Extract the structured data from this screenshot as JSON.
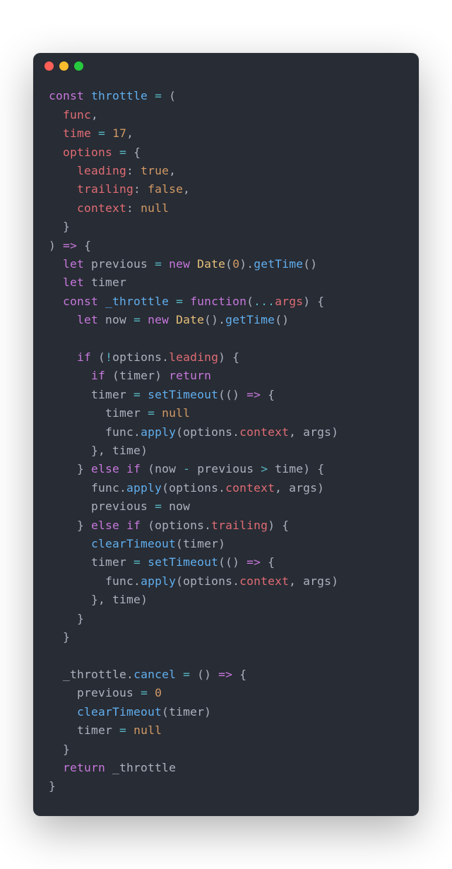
{
  "window": {
    "buttons": [
      "close",
      "minimize",
      "maximize"
    ]
  },
  "code": {
    "language": "javascript",
    "tokens": [
      {
        "t": "kw",
        "v": "const"
      },
      {
        "t": "sp",
        "v": " "
      },
      {
        "t": "fn",
        "v": "throttle"
      },
      {
        "t": "sp",
        "v": " "
      },
      {
        "t": "op",
        "v": "="
      },
      {
        "t": "sp",
        "v": " "
      },
      {
        "t": "punct",
        "v": "("
      },
      {
        "t": "nl"
      },
      {
        "t": "sp",
        "v": "  "
      },
      {
        "t": "str-param",
        "v": "func"
      },
      {
        "t": "punct",
        "v": ","
      },
      {
        "t": "nl"
      },
      {
        "t": "sp",
        "v": "  "
      },
      {
        "t": "str-param",
        "v": "time"
      },
      {
        "t": "sp",
        "v": " "
      },
      {
        "t": "op",
        "v": "="
      },
      {
        "t": "sp",
        "v": " "
      },
      {
        "t": "num",
        "v": "17"
      },
      {
        "t": "punct",
        "v": ","
      },
      {
        "t": "nl"
      },
      {
        "t": "sp",
        "v": "  "
      },
      {
        "t": "str-param",
        "v": "options"
      },
      {
        "t": "sp",
        "v": " "
      },
      {
        "t": "op",
        "v": "="
      },
      {
        "t": "sp",
        "v": " "
      },
      {
        "t": "punct",
        "v": "{"
      },
      {
        "t": "nl"
      },
      {
        "t": "sp",
        "v": "    "
      },
      {
        "t": "prop",
        "v": "leading"
      },
      {
        "t": "punct",
        "v": ":"
      },
      {
        "t": "sp",
        "v": " "
      },
      {
        "t": "bool",
        "v": "true"
      },
      {
        "t": "punct",
        "v": ","
      },
      {
        "t": "nl"
      },
      {
        "t": "sp",
        "v": "    "
      },
      {
        "t": "prop",
        "v": "trailing"
      },
      {
        "t": "punct",
        "v": ":"
      },
      {
        "t": "sp",
        "v": " "
      },
      {
        "t": "bool",
        "v": "false"
      },
      {
        "t": "punct",
        "v": ","
      },
      {
        "t": "nl"
      },
      {
        "t": "sp",
        "v": "    "
      },
      {
        "t": "prop",
        "v": "context"
      },
      {
        "t": "punct",
        "v": ":"
      },
      {
        "t": "sp",
        "v": " "
      },
      {
        "t": "null",
        "v": "null"
      },
      {
        "t": "nl"
      },
      {
        "t": "sp",
        "v": "  "
      },
      {
        "t": "punct",
        "v": "}"
      },
      {
        "t": "nl"
      },
      {
        "t": "punct",
        "v": ")"
      },
      {
        "t": "sp",
        "v": " "
      },
      {
        "t": "kw",
        "v": "=>"
      },
      {
        "t": "sp",
        "v": " "
      },
      {
        "t": "punct",
        "v": "{"
      },
      {
        "t": "nl"
      },
      {
        "t": "sp",
        "v": "  "
      },
      {
        "t": "kw",
        "v": "let"
      },
      {
        "t": "sp",
        "v": " "
      },
      {
        "t": "ident",
        "v": "previous"
      },
      {
        "t": "sp",
        "v": " "
      },
      {
        "t": "op",
        "v": "="
      },
      {
        "t": "sp",
        "v": " "
      },
      {
        "t": "newkw",
        "v": "new"
      },
      {
        "t": "sp",
        "v": " "
      },
      {
        "t": "cls",
        "v": "Date"
      },
      {
        "t": "punct",
        "v": "("
      },
      {
        "t": "num",
        "v": "0"
      },
      {
        "t": "punct",
        "v": ")."
      },
      {
        "t": "method",
        "v": "getTime"
      },
      {
        "t": "punct",
        "v": "()"
      },
      {
        "t": "nl"
      },
      {
        "t": "sp",
        "v": "  "
      },
      {
        "t": "kw",
        "v": "let"
      },
      {
        "t": "sp",
        "v": " "
      },
      {
        "t": "ident",
        "v": "timer"
      },
      {
        "t": "nl"
      },
      {
        "t": "sp",
        "v": "  "
      },
      {
        "t": "kw",
        "v": "const"
      },
      {
        "t": "sp",
        "v": " "
      },
      {
        "t": "fn",
        "v": "_throttle"
      },
      {
        "t": "sp",
        "v": " "
      },
      {
        "t": "op",
        "v": "="
      },
      {
        "t": "sp",
        "v": " "
      },
      {
        "t": "kw",
        "v": "function"
      },
      {
        "t": "punct",
        "v": "("
      },
      {
        "t": "op",
        "v": "..."
      },
      {
        "t": "str-param",
        "v": "args"
      },
      {
        "t": "punct",
        "v": ")"
      },
      {
        "t": "sp",
        "v": " "
      },
      {
        "t": "punct",
        "v": "{"
      },
      {
        "t": "nl"
      },
      {
        "t": "sp",
        "v": "    "
      },
      {
        "t": "kw",
        "v": "let"
      },
      {
        "t": "sp",
        "v": " "
      },
      {
        "t": "ident",
        "v": "now"
      },
      {
        "t": "sp",
        "v": " "
      },
      {
        "t": "op",
        "v": "="
      },
      {
        "t": "sp",
        "v": " "
      },
      {
        "t": "newkw",
        "v": "new"
      },
      {
        "t": "sp",
        "v": " "
      },
      {
        "t": "cls",
        "v": "Date"
      },
      {
        "t": "punct",
        "v": "()."
      },
      {
        "t": "method",
        "v": "getTime"
      },
      {
        "t": "punct",
        "v": "()"
      },
      {
        "t": "nl"
      },
      {
        "t": "nl"
      },
      {
        "t": "sp",
        "v": "    "
      },
      {
        "t": "kw",
        "v": "if"
      },
      {
        "t": "sp",
        "v": " "
      },
      {
        "t": "punct",
        "v": "("
      },
      {
        "t": "op",
        "v": "!"
      },
      {
        "t": "ident",
        "v": "options"
      },
      {
        "t": "punct",
        "v": "."
      },
      {
        "t": "prop",
        "v": "leading"
      },
      {
        "t": "punct",
        "v": ")"
      },
      {
        "t": "sp",
        "v": " "
      },
      {
        "t": "punct",
        "v": "{"
      },
      {
        "t": "nl"
      },
      {
        "t": "sp",
        "v": "      "
      },
      {
        "t": "kw",
        "v": "if"
      },
      {
        "t": "sp",
        "v": " "
      },
      {
        "t": "punct",
        "v": "("
      },
      {
        "t": "ident",
        "v": "timer"
      },
      {
        "t": "punct",
        "v": ")"
      },
      {
        "t": "sp",
        "v": " "
      },
      {
        "t": "kw",
        "v": "return"
      },
      {
        "t": "nl"
      },
      {
        "t": "sp",
        "v": "      "
      },
      {
        "t": "ident",
        "v": "timer"
      },
      {
        "t": "sp",
        "v": " "
      },
      {
        "t": "op",
        "v": "="
      },
      {
        "t": "sp",
        "v": " "
      },
      {
        "t": "method",
        "v": "setTimeout"
      },
      {
        "t": "punct",
        "v": "(()"
      },
      {
        "t": "sp",
        "v": " "
      },
      {
        "t": "kw",
        "v": "=>"
      },
      {
        "t": "sp",
        "v": " "
      },
      {
        "t": "punct",
        "v": "{"
      },
      {
        "t": "nl"
      },
      {
        "t": "sp",
        "v": "        "
      },
      {
        "t": "ident",
        "v": "timer"
      },
      {
        "t": "sp",
        "v": " "
      },
      {
        "t": "op",
        "v": "="
      },
      {
        "t": "sp",
        "v": " "
      },
      {
        "t": "null",
        "v": "null"
      },
      {
        "t": "nl"
      },
      {
        "t": "sp",
        "v": "        "
      },
      {
        "t": "ident",
        "v": "func"
      },
      {
        "t": "punct",
        "v": "."
      },
      {
        "t": "method",
        "v": "apply"
      },
      {
        "t": "punct",
        "v": "("
      },
      {
        "t": "ident",
        "v": "options"
      },
      {
        "t": "punct",
        "v": "."
      },
      {
        "t": "prop",
        "v": "context"
      },
      {
        "t": "punct",
        "v": ","
      },
      {
        "t": "sp",
        "v": " "
      },
      {
        "t": "ident",
        "v": "args"
      },
      {
        "t": "punct",
        "v": ")"
      },
      {
        "t": "nl"
      },
      {
        "t": "sp",
        "v": "      "
      },
      {
        "t": "punct",
        "v": "},"
      },
      {
        "t": "sp",
        "v": " "
      },
      {
        "t": "ident",
        "v": "time"
      },
      {
        "t": "punct",
        "v": ")"
      },
      {
        "t": "nl"
      },
      {
        "t": "sp",
        "v": "    "
      },
      {
        "t": "punct",
        "v": "}"
      },
      {
        "t": "sp",
        "v": " "
      },
      {
        "t": "kw",
        "v": "else"
      },
      {
        "t": "sp",
        "v": " "
      },
      {
        "t": "kw",
        "v": "if"
      },
      {
        "t": "sp",
        "v": " "
      },
      {
        "t": "punct",
        "v": "("
      },
      {
        "t": "ident",
        "v": "now"
      },
      {
        "t": "sp",
        "v": " "
      },
      {
        "t": "op",
        "v": "-"
      },
      {
        "t": "sp",
        "v": " "
      },
      {
        "t": "ident",
        "v": "previous"
      },
      {
        "t": "sp",
        "v": " "
      },
      {
        "t": "op",
        "v": ">"
      },
      {
        "t": "sp",
        "v": " "
      },
      {
        "t": "ident",
        "v": "time"
      },
      {
        "t": "punct",
        "v": ")"
      },
      {
        "t": "sp",
        "v": " "
      },
      {
        "t": "punct",
        "v": "{"
      },
      {
        "t": "nl"
      },
      {
        "t": "sp",
        "v": "      "
      },
      {
        "t": "ident",
        "v": "func"
      },
      {
        "t": "punct",
        "v": "."
      },
      {
        "t": "method",
        "v": "apply"
      },
      {
        "t": "punct",
        "v": "("
      },
      {
        "t": "ident",
        "v": "options"
      },
      {
        "t": "punct",
        "v": "."
      },
      {
        "t": "prop",
        "v": "context"
      },
      {
        "t": "punct",
        "v": ","
      },
      {
        "t": "sp",
        "v": " "
      },
      {
        "t": "ident",
        "v": "args"
      },
      {
        "t": "punct",
        "v": ")"
      },
      {
        "t": "nl"
      },
      {
        "t": "sp",
        "v": "      "
      },
      {
        "t": "ident",
        "v": "previous"
      },
      {
        "t": "sp",
        "v": " "
      },
      {
        "t": "op",
        "v": "="
      },
      {
        "t": "sp",
        "v": " "
      },
      {
        "t": "ident",
        "v": "now"
      },
      {
        "t": "nl"
      },
      {
        "t": "sp",
        "v": "    "
      },
      {
        "t": "punct",
        "v": "}"
      },
      {
        "t": "sp",
        "v": " "
      },
      {
        "t": "kw",
        "v": "else"
      },
      {
        "t": "sp",
        "v": " "
      },
      {
        "t": "kw",
        "v": "if"
      },
      {
        "t": "sp",
        "v": " "
      },
      {
        "t": "punct",
        "v": "("
      },
      {
        "t": "ident",
        "v": "options"
      },
      {
        "t": "punct",
        "v": "."
      },
      {
        "t": "prop",
        "v": "trailing"
      },
      {
        "t": "punct",
        "v": ")"
      },
      {
        "t": "sp",
        "v": " "
      },
      {
        "t": "punct",
        "v": "{"
      },
      {
        "t": "nl"
      },
      {
        "t": "sp",
        "v": "      "
      },
      {
        "t": "method",
        "v": "clearTimeout"
      },
      {
        "t": "punct",
        "v": "("
      },
      {
        "t": "ident",
        "v": "timer"
      },
      {
        "t": "punct",
        "v": ")"
      },
      {
        "t": "nl"
      },
      {
        "t": "sp",
        "v": "      "
      },
      {
        "t": "ident",
        "v": "timer"
      },
      {
        "t": "sp",
        "v": " "
      },
      {
        "t": "op",
        "v": "="
      },
      {
        "t": "sp",
        "v": " "
      },
      {
        "t": "method",
        "v": "setTimeout"
      },
      {
        "t": "punct",
        "v": "(()"
      },
      {
        "t": "sp",
        "v": " "
      },
      {
        "t": "kw",
        "v": "=>"
      },
      {
        "t": "sp",
        "v": " "
      },
      {
        "t": "punct",
        "v": "{"
      },
      {
        "t": "nl"
      },
      {
        "t": "sp",
        "v": "        "
      },
      {
        "t": "ident",
        "v": "func"
      },
      {
        "t": "punct",
        "v": "."
      },
      {
        "t": "method",
        "v": "apply"
      },
      {
        "t": "punct",
        "v": "("
      },
      {
        "t": "ident",
        "v": "options"
      },
      {
        "t": "punct",
        "v": "."
      },
      {
        "t": "prop",
        "v": "context"
      },
      {
        "t": "punct",
        "v": ","
      },
      {
        "t": "sp",
        "v": " "
      },
      {
        "t": "ident",
        "v": "args"
      },
      {
        "t": "punct",
        "v": ")"
      },
      {
        "t": "nl"
      },
      {
        "t": "sp",
        "v": "      "
      },
      {
        "t": "punct",
        "v": "},"
      },
      {
        "t": "sp",
        "v": " "
      },
      {
        "t": "ident",
        "v": "time"
      },
      {
        "t": "punct",
        "v": ")"
      },
      {
        "t": "nl"
      },
      {
        "t": "sp",
        "v": "    "
      },
      {
        "t": "punct",
        "v": "}"
      },
      {
        "t": "nl"
      },
      {
        "t": "sp",
        "v": "  "
      },
      {
        "t": "punct",
        "v": "}"
      },
      {
        "t": "nl"
      },
      {
        "t": "nl"
      },
      {
        "t": "sp",
        "v": "  "
      },
      {
        "t": "ident",
        "v": "_throttle"
      },
      {
        "t": "punct",
        "v": "."
      },
      {
        "t": "fn",
        "v": "cancel"
      },
      {
        "t": "sp",
        "v": " "
      },
      {
        "t": "op",
        "v": "="
      },
      {
        "t": "sp",
        "v": " "
      },
      {
        "t": "punct",
        "v": "()"
      },
      {
        "t": "sp",
        "v": " "
      },
      {
        "t": "kw",
        "v": "=>"
      },
      {
        "t": "sp",
        "v": " "
      },
      {
        "t": "punct",
        "v": "{"
      },
      {
        "t": "nl"
      },
      {
        "t": "sp",
        "v": "    "
      },
      {
        "t": "ident",
        "v": "previous"
      },
      {
        "t": "sp",
        "v": " "
      },
      {
        "t": "op",
        "v": "="
      },
      {
        "t": "sp",
        "v": " "
      },
      {
        "t": "num",
        "v": "0"
      },
      {
        "t": "nl"
      },
      {
        "t": "sp",
        "v": "    "
      },
      {
        "t": "method",
        "v": "clearTimeout"
      },
      {
        "t": "punct",
        "v": "("
      },
      {
        "t": "ident",
        "v": "timer"
      },
      {
        "t": "punct",
        "v": ")"
      },
      {
        "t": "nl"
      },
      {
        "t": "sp",
        "v": "    "
      },
      {
        "t": "ident",
        "v": "timer"
      },
      {
        "t": "sp",
        "v": " "
      },
      {
        "t": "op",
        "v": "="
      },
      {
        "t": "sp",
        "v": " "
      },
      {
        "t": "null",
        "v": "null"
      },
      {
        "t": "nl"
      },
      {
        "t": "sp",
        "v": "  "
      },
      {
        "t": "punct",
        "v": "}"
      },
      {
        "t": "nl"
      },
      {
        "t": "sp",
        "v": "  "
      },
      {
        "t": "kw",
        "v": "return"
      },
      {
        "t": "sp",
        "v": " "
      },
      {
        "t": "ident",
        "v": "_throttle"
      },
      {
        "t": "nl"
      },
      {
        "t": "punct",
        "v": "}"
      }
    ]
  }
}
